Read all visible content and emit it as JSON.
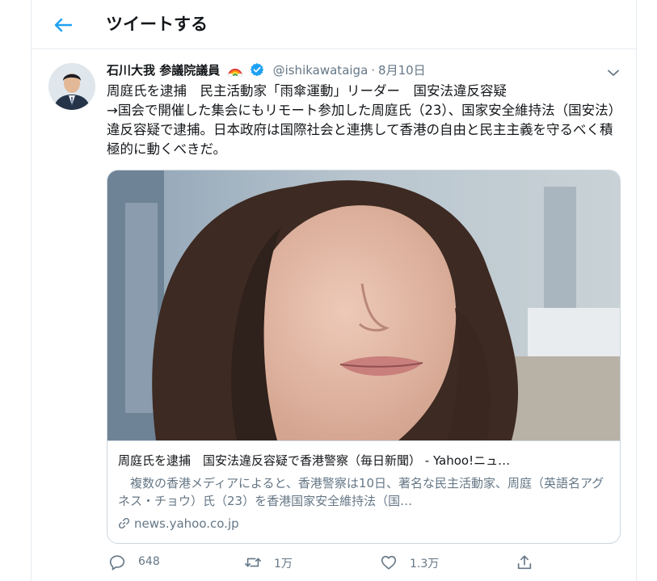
{
  "header": {
    "title": "ツイートする",
    "back_icon": "arrow-left-icon"
  },
  "colors": {
    "accent": "#1da1f2",
    "secondary_text": "#657786",
    "border": "#e6ecf0"
  },
  "tweet": {
    "author_name": "石川大我 参議院議員",
    "handle": "@ishikawataiga",
    "separator": "·",
    "time": "8月10日",
    "text": "周庭氏を逮捕　民主活動家「雨傘運動」リーダー　国安法違反容疑\n→国会で開催した集会にもリモート参加した周庭氏（23）、国家安全維持法（国安法）違反容疑で逮捕。日本政府は国際社会と連携して香港の自由と民主主義を守るべく積極的に動くべきだ。"
  },
  "card": {
    "title": "周庭氏を逮捕　国安法違反容疑で香港警察（毎日新聞） - Yahoo!ニュ…",
    "description": "　複数の香港メディアによると、香港警察は10日、著名な民主活動家、周庭（英語名アグネス・チョウ）氏（23）を香港国家安全維持法（国…",
    "link": "news.yahoo.co.jp"
  },
  "actions": {
    "reply_count": "648",
    "retweet_count": "1万",
    "like_count": "1.3万",
    "share_count": ""
  }
}
